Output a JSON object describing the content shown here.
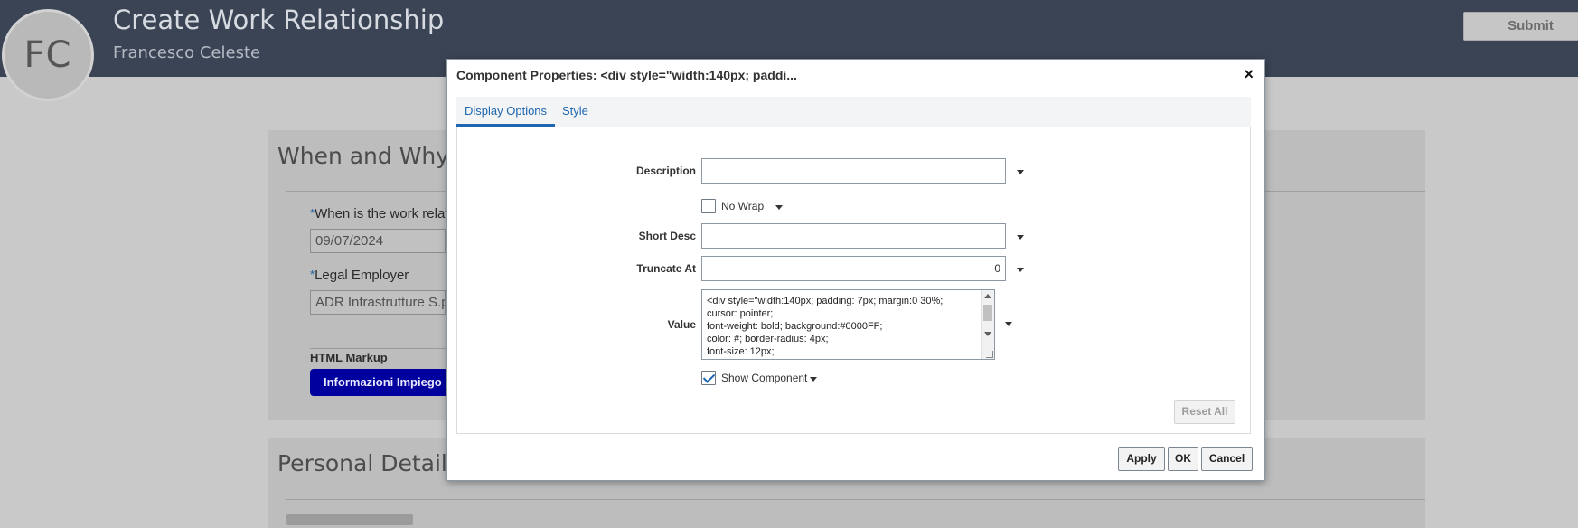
{
  "page": {
    "title": "Create Work Relationship",
    "subtitle": "Francesco Celeste",
    "avatar_initials": "FC",
    "submit_label": "Submit"
  },
  "when_why": {
    "title": "When and Why",
    "date_label": "When is the work relat",
    "date_value": "09/07/2024",
    "employer_label": "Legal Employer",
    "employer_value": "ADR Infrastrutture S.p.",
    "html_markup_label": "HTML Markup",
    "info_button_label": "Informazioni Impiego",
    "required_marker": "*"
  },
  "personal": {
    "title": "Personal Details"
  },
  "dialog": {
    "title": "Component Properties: <div style=\"width:140px; paddi...",
    "close_label": "×",
    "tabs": [
      {
        "label": "Display Options",
        "active": true
      },
      {
        "label": "Style",
        "active": false
      }
    ],
    "description_label": "Description",
    "description_value": "",
    "no_wrap_label": "No Wrap",
    "short_desc_label": "Short Desc",
    "short_desc_value": "",
    "truncate_label": "Truncate At",
    "truncate_value": "0",
    "value_label": "Value",
    "value_text": "<div style=\"width:140px; padding: 7px; margin:0 30%;\ncursor: pointer;\nfont-weight: bold; background:#0000FF;\ncolor: #; border-radius: 4px;\nfont-size: 12px;",
    "show_component_label": "Show Component",
    "show_component_checked": true,
    "no_wrap_checked": false,
    "reset_label": "Reset All",
    "apply_label": "Apply",
    "ok_label": "OK",
    "cancel_label": "Cancel"
  },
  "colors": {
    "header_bg": "#3a4454",
    "accent": "#1d66b0",
    "info_button_bg": "#00009e"
  }
}
